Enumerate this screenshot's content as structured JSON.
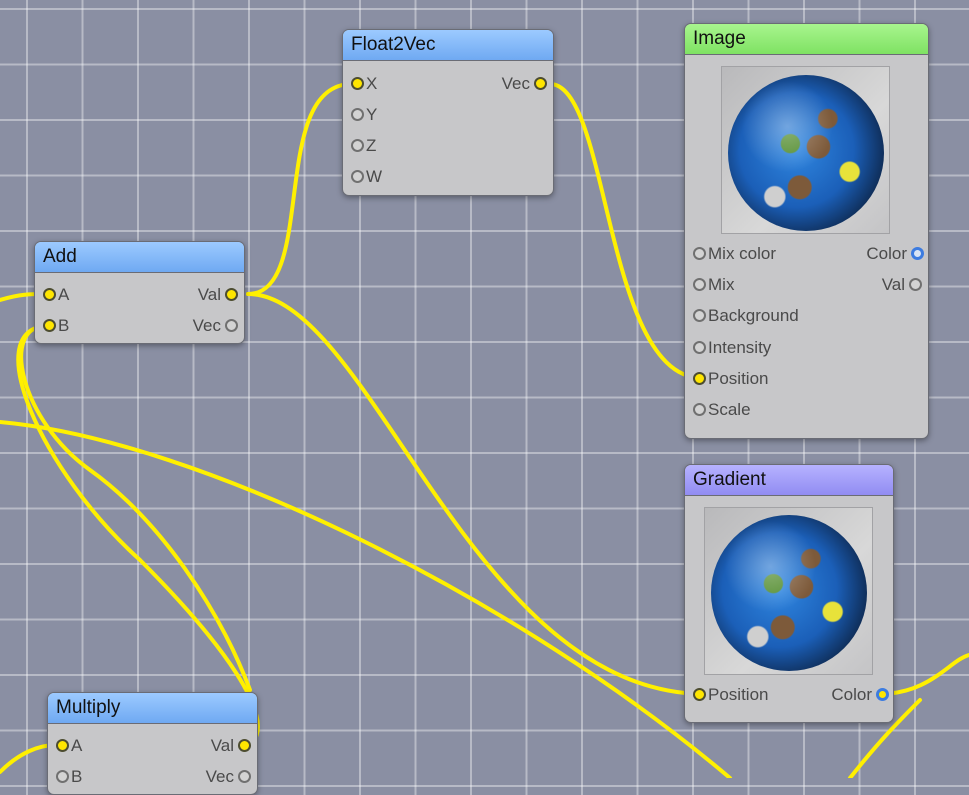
{
  "nodes": {
    "float2vec": {
      "title": "Float2Vec",
      "inputs": [
        "X",
        "Y",
        "Z",
        "W"
      ],
      "outputs": [
        "Vec"
      ]
    },
    "image": {
      "title": "Image",
      "inputs": [
        "Mix color",
        "Mix",
        "Background",
        "Intensity",
        "Position",
        "Scale"
      ],
      "outputs": [
        "Color",
        "Val"
      ]
    },
    "add": {
      "title": "Add",
      "inputs": [
        "A",
        "B"
      ],
      "outputs": [
        "Val",
        "Vec"
      ]
    },
    "gradient": {
      "title": "Gradient",
      "inputs": [
        "Position"
      ],
      "outputs": [
        "Color"
      ]
    },
    "multiply": {
      "title": "Multiply",
      "inputs": [
        "A",
        "B"
      ],
      "outputs": [
        "Val",
        "Vec"
      ]
    }
  },
  "colors": {
    "canvas": "#8a8fa3",
    "wire": "#fff000",
    "title_blue": "#7fb5f7",
    "title_green": "#8fec72",
    "title_purple": "#a3a0fa",
    "port_connected": "#ffe600",
    "port_output_highlight": "#3d7ce0"
  }
}
